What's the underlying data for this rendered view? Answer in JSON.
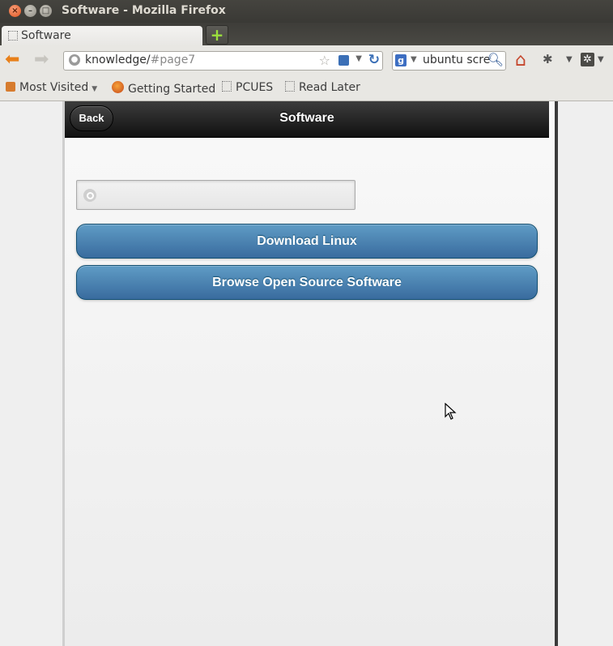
{
  "window": {
    "title": "Software - Mozilla Firefox"
  },
  "tabs": [
    {
      "label": "Software"
    }
  ],
  "navbar": {
    "url_host": "knowledge/",
    "url_path": "#page7",
    "search_query": "ubuntu scree"
  },
  "bookmarks": [
    {
      "label": "Most Visited",
      "icon": "folder-icon"
    },
    {
      "label": "Getting Started",
      "icon": "firefox-icon"
    },
    {
      "label": "PCUES",
      "icon": "page-icon"
    },
    {
      "label": "Read Later",
      "icon": "page-icon"
    }
  ],
  "page": {
    "title": "Software",
    "back_label": "Back",
    "search_placeholder": "",
    "buttons": [
      {
        "label": "Download Linux"
      },
      {
        "label": "Browse Open Source Software"
      }
    ]
  },
  "colors": {
    "header_dark": "#111111",
    "button_blue": "#396b9e",
    "firefox_orange": "#e8801a"
  }
}
